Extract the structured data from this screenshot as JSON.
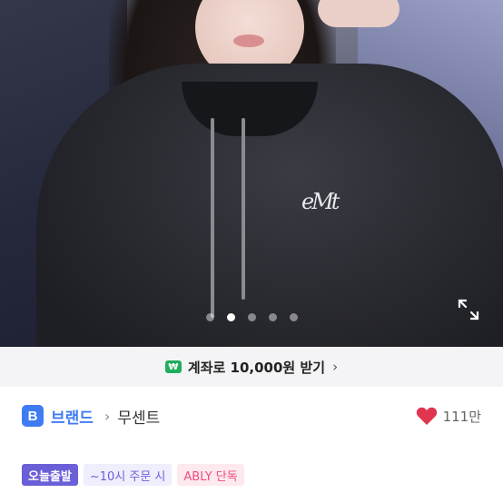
{
  "carousel": {
    "total_images": 5,
    "current_index": 2,
    "garment_logo_text": "eMt"
  },
  "promo": {
    "icon_symbol": "₩",
    "text": "계좌로 10,000원 받기",
    "chevron": "›"
  },
  "brand": {
    "badge_letter": "B",
    "type_label": "브랜드",
    "separator": "›",
    "name": "무센트"
  },
  "likes": {
    "count": "111만"
  },
  "tags": {
    "today_shipping": "오늘출발",
    "order_deadline": "~10시 주문 시",
    "ably_exclusive": "ABLY 단독"
  },
  "colors": {
    "brand_blue": "#3f7cf4",
    "heart_red": "#e0344f",
    "tag_purple": "#6b5fd8",
    "ably_pink": "#ef4d7b",
    "promo_green": "#1fae5e"
  }
}
